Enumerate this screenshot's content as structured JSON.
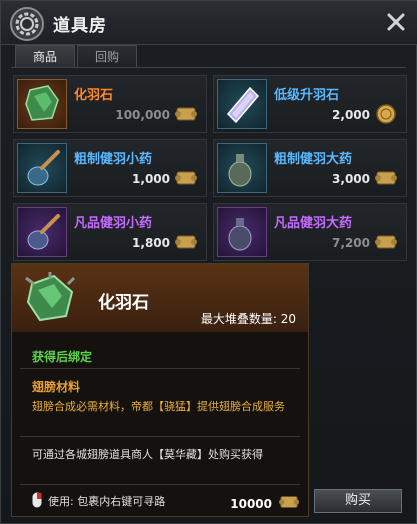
{
  "window": {
    "title": "道具房"
  },
  "tabs": [
    {
      "label": "商品",
      "active": true
    },
    {
      "label": "回购",
      "active": false
    }
  ],
  "items": [
    {
      "name": "化羽石",
      "price": "100,000",
      "rarity": "orange",
      "currency": "scroll-icon",
      "dim": true
    },
    {
      "name": "低级升羽石",
      "price": "2,000",
      "rarity": "blue",
      "currency": "gold-coin-icon",
      "dim": false
    },
    {
      "name": "粗制健羽小药",
      "price": "1,000",
      "rarity": "blue",
      "currency": "scroll-icon",
      "dim": false
    },
    {
      "name": "粗制健羽大药",
      "price": "3,000",
      "rarity": "blue",
      "currency": "scroll-icon",
      "dim": false
    },
    {
      "name": "凡品健羽小药",
      "price": "1,800",
      "rarity": "purple",
      "currency": "scroll-icon",
      "dim": false
    },
    {
      "name": "凡品健羽大药",
      "price": "7,200",
      "rarity": "purple",
      "currency": "scroll-icon",
      "dim": true
    }
  ],
  "tooltip": {
    "name": "化羽石",
    "stack": "最大堆叠数量: 20",
    "bind": "获得后绑定",
    "category": "翅膀材料",
    "description": "翅膀合成必需材料，帝都【骁猛】提供翅膀合成服务",
    "source": "可通过各城翅膀道具商人【莫华藏】处购买获得",
    "usage": "使用: 包裹内右键可寻路",
    "price": "10000"
  },
  "buy_button": "购买",
  "colors": {
    "orange": "#ff8a2a",
    "blue": "#5ab8ff",
    "purple": "#c46aff",
    "bind_green": "#5bd44c",
    "category_gold": "#e6a030"
  }
}
